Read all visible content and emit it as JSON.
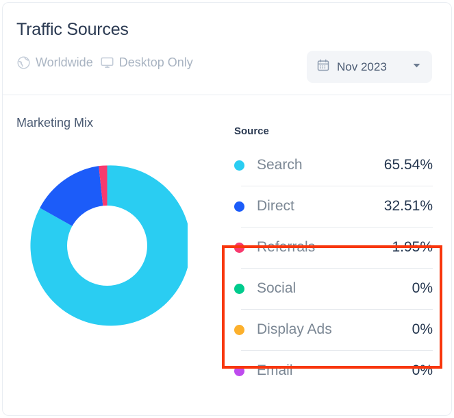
{
  "header": {
    "title": "Traffic Sources",
    "filters": [
      {
        "icon": "globe-icon",
        "label": "Worldwide"
      },
      {
        "icon": "desktop-icon",
        "label": "Desktop Only"
      }
    ],
    "date_picker": {
      "icon": "calendar-icon",
      "value": "Nov 2023",
      "chevron": "chevron-down-icon"
    }
  },
  "body": {
    "section_title": "Marketing Mix",
    "legend_header": "Source"
  },
  "colors": {
    "search": "#2ACDF2",
    "direct": "#1C5CF9",
    "referrals": "#F83A6E",
    "social": "#00CB8D",
    "display_ads": "#FCB02C",
    "email": "#BE4BEE",
    "highlight": "#F8370D",
    "title_text": "#2b3a52",
    "label_text": "#7b8794",
    "value_text": "#22344d",
    "muted_text": "#a9b4c2",
    "divider": "#e7eaee",
    "chip_bg": "#f3f5f8"
  },
  "chart_data": {
    "type": "pie",
    "title": "Marketing Mix",
    "subtitle": "Traffic Sources",
    "donut": true,
    "categories": [
      "Search",
      "Direct",
      "Referrals",
      "Social",
      "Display Ads",
      "Email"
    ],
    "values": [
      65.54,
      32.51,
      1.95,
      0,
      0,
      0
    ],
    "value_labels": [
      "65.54%",
      "32.51%",
      "1.95%",
      "0%",
      "0%",
      "0%"
    ],
    "colors": [
      "#2ACDF2",
      "#1C5CF9",
      "#F83A6E",
      "#00CB8D",
      "#FCB02C",
      "#BE4BEE"
    ],
    "unit": "%",
    "start_angle": 0,
    "direction": "clockwise",
    "legend_position": "right",
    "legend_columns": [
      "Source",
      ""
    ],
    "grid": false,
    "xlabel": "",
    "ylabel": ""
  },
  "legend_rows": [
    {
      "label": "Search",
      "value": "65.54%",
      "color": "#2ACDF2",
      "highlighted": true
    },
    {
      "label": "Direct",
      "value": "32.51%",
      "color": "#1C5CF9",
      "highlighted": true
    },
    {
      "label": "Referrals",
      "value": "1.95%",
      "color": "#F83A6E",
      "highlighted": true
    },
    {
      "label": "Social",
      "value": "0%",
      "color": "#00CB8D",
      "highlighted": false
    },
    {
      "label": "Display Ads",
      "value": "0%",
      "color": "#FCB02C",
      "highlighted": false
    },
    {
      "label": "Email",
      "value": "0%",
      "color": "#BE4BEE",
      "highlighted": false
    }
  ]
}
